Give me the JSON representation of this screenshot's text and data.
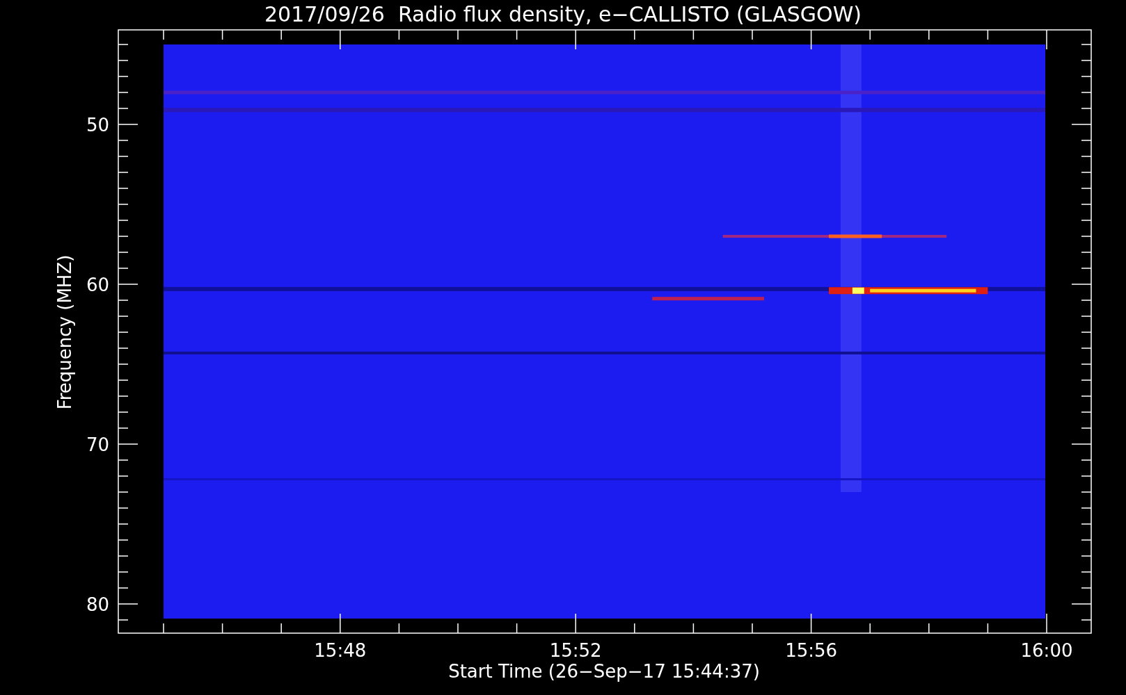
{
  "title": "2017/09/26  Radio flux density, e−CALLISTO (GLASGOW)",
  "y_axis": {
    "label": "Frequency (MHZ)",
    "tick_labels": [
      "50",
      "60",
      "70",
      "80"
    ]
  },
  "x_axis": {
    "label": "Start Time (26−Sep−17 15:44:37)",
    "tick_labels": [
      "15:48",
      "15:52",
      "15:56",
      "16:00"
    ]
  }
}
